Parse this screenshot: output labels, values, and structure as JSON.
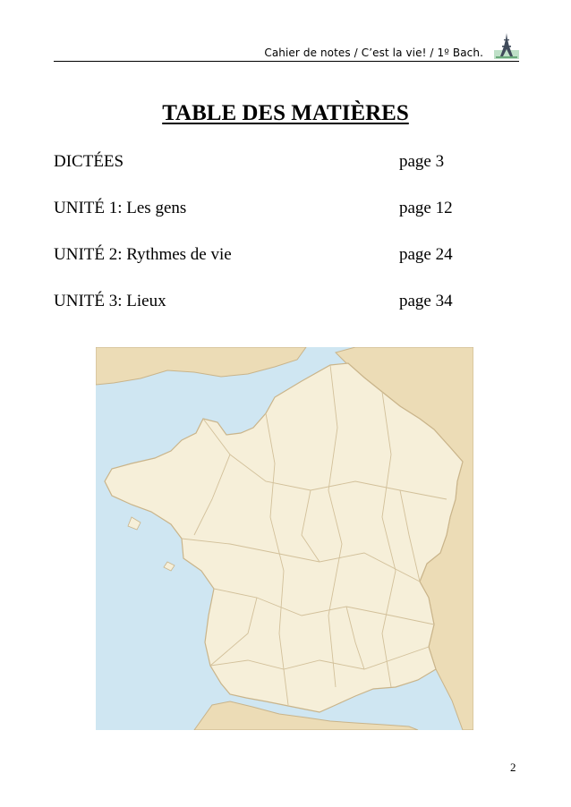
{
  "header": {
    "running_title": "Cahier de notes / C’est la vie! / 1º Bach.",
    "logo_icon": "eiffel-tower-icon"
  },
  "title": "TABLE DES MATIÈRES",
  "toc": [
    {
      "label": "DICTÉES",
      "page": "page 3"
    },
    {
      "label": "UNITÉ 1: Les gens",
      "page": "page 12"
    },
    {
      "label": "UNITÉ 2: Rythmes de vie",
      "page": "page 24"
    },
    {
      "label": "UNITÉ 3: Lieux",
      "page": "page 34"
    }
  ],
  "map": {
    "subject": "france-regions-map",
    "colors": {
      "sea": "#cfe6f2",
      "france": "#f6efd9",
      "neighbors": "#ecdcb6",
      "borders": "#c9b48a"
    }
  },
  "page_number": "2"
}
